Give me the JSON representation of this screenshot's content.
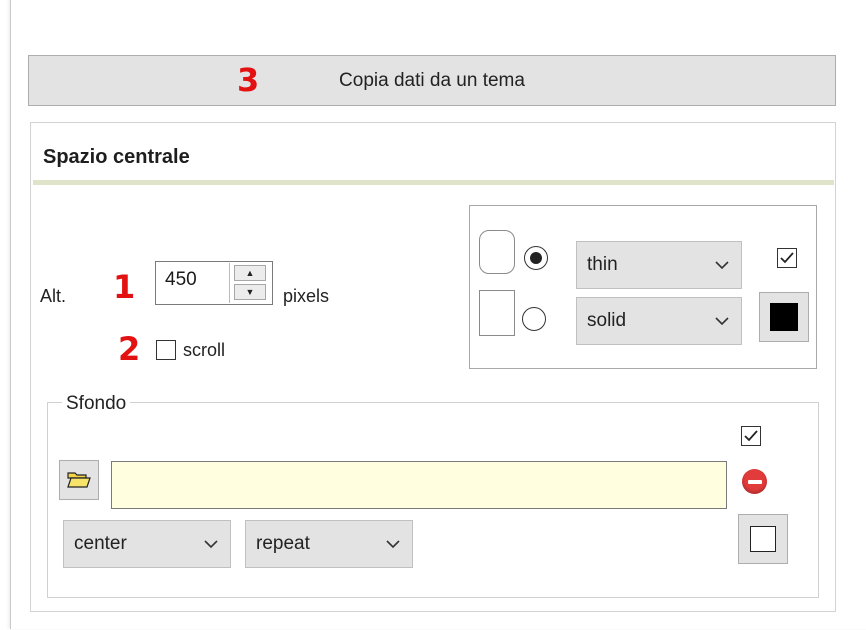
{
  "copy_button": {
    "label": "Copia dati da un tema",
    "badge": "3"
  },
  "section": {
    "title": "Spazio centrale"
  },
  "height": {
    "label": "Alt.",
    "badge": "1",
    "value": "450",
    "unit": "pixels"
  },
  "scroll": {
    "badge": "2",
    "label": "scroll",
    "checked": false
  },
  "border": {
    "shape_options": [
      "rounded",
      "square"
    ],
    "selected_shape": "rounded",
    "width_value": "thin",
    "style_value": "solid",
    "enabled": true,
    "color": "#000000"
  },
  "background": {
    "legend": "Sfondo",
    "enabled": true,
    "image_path": "",
    "position_value": "center",
    "repeat_value": "repeat",
    "color": "#ffffff",
    "input_color": "#ffffe0"
  },
  "icons": {
    "spin_up": "spin-up-icon",
    "spin_down": "spin-down-icon",
    "chevron": "chevron-down-icon",
    "folder": "folder-open-icon",
    "remove": "remove-icon",
    "check": "check-icon"
  }
}
